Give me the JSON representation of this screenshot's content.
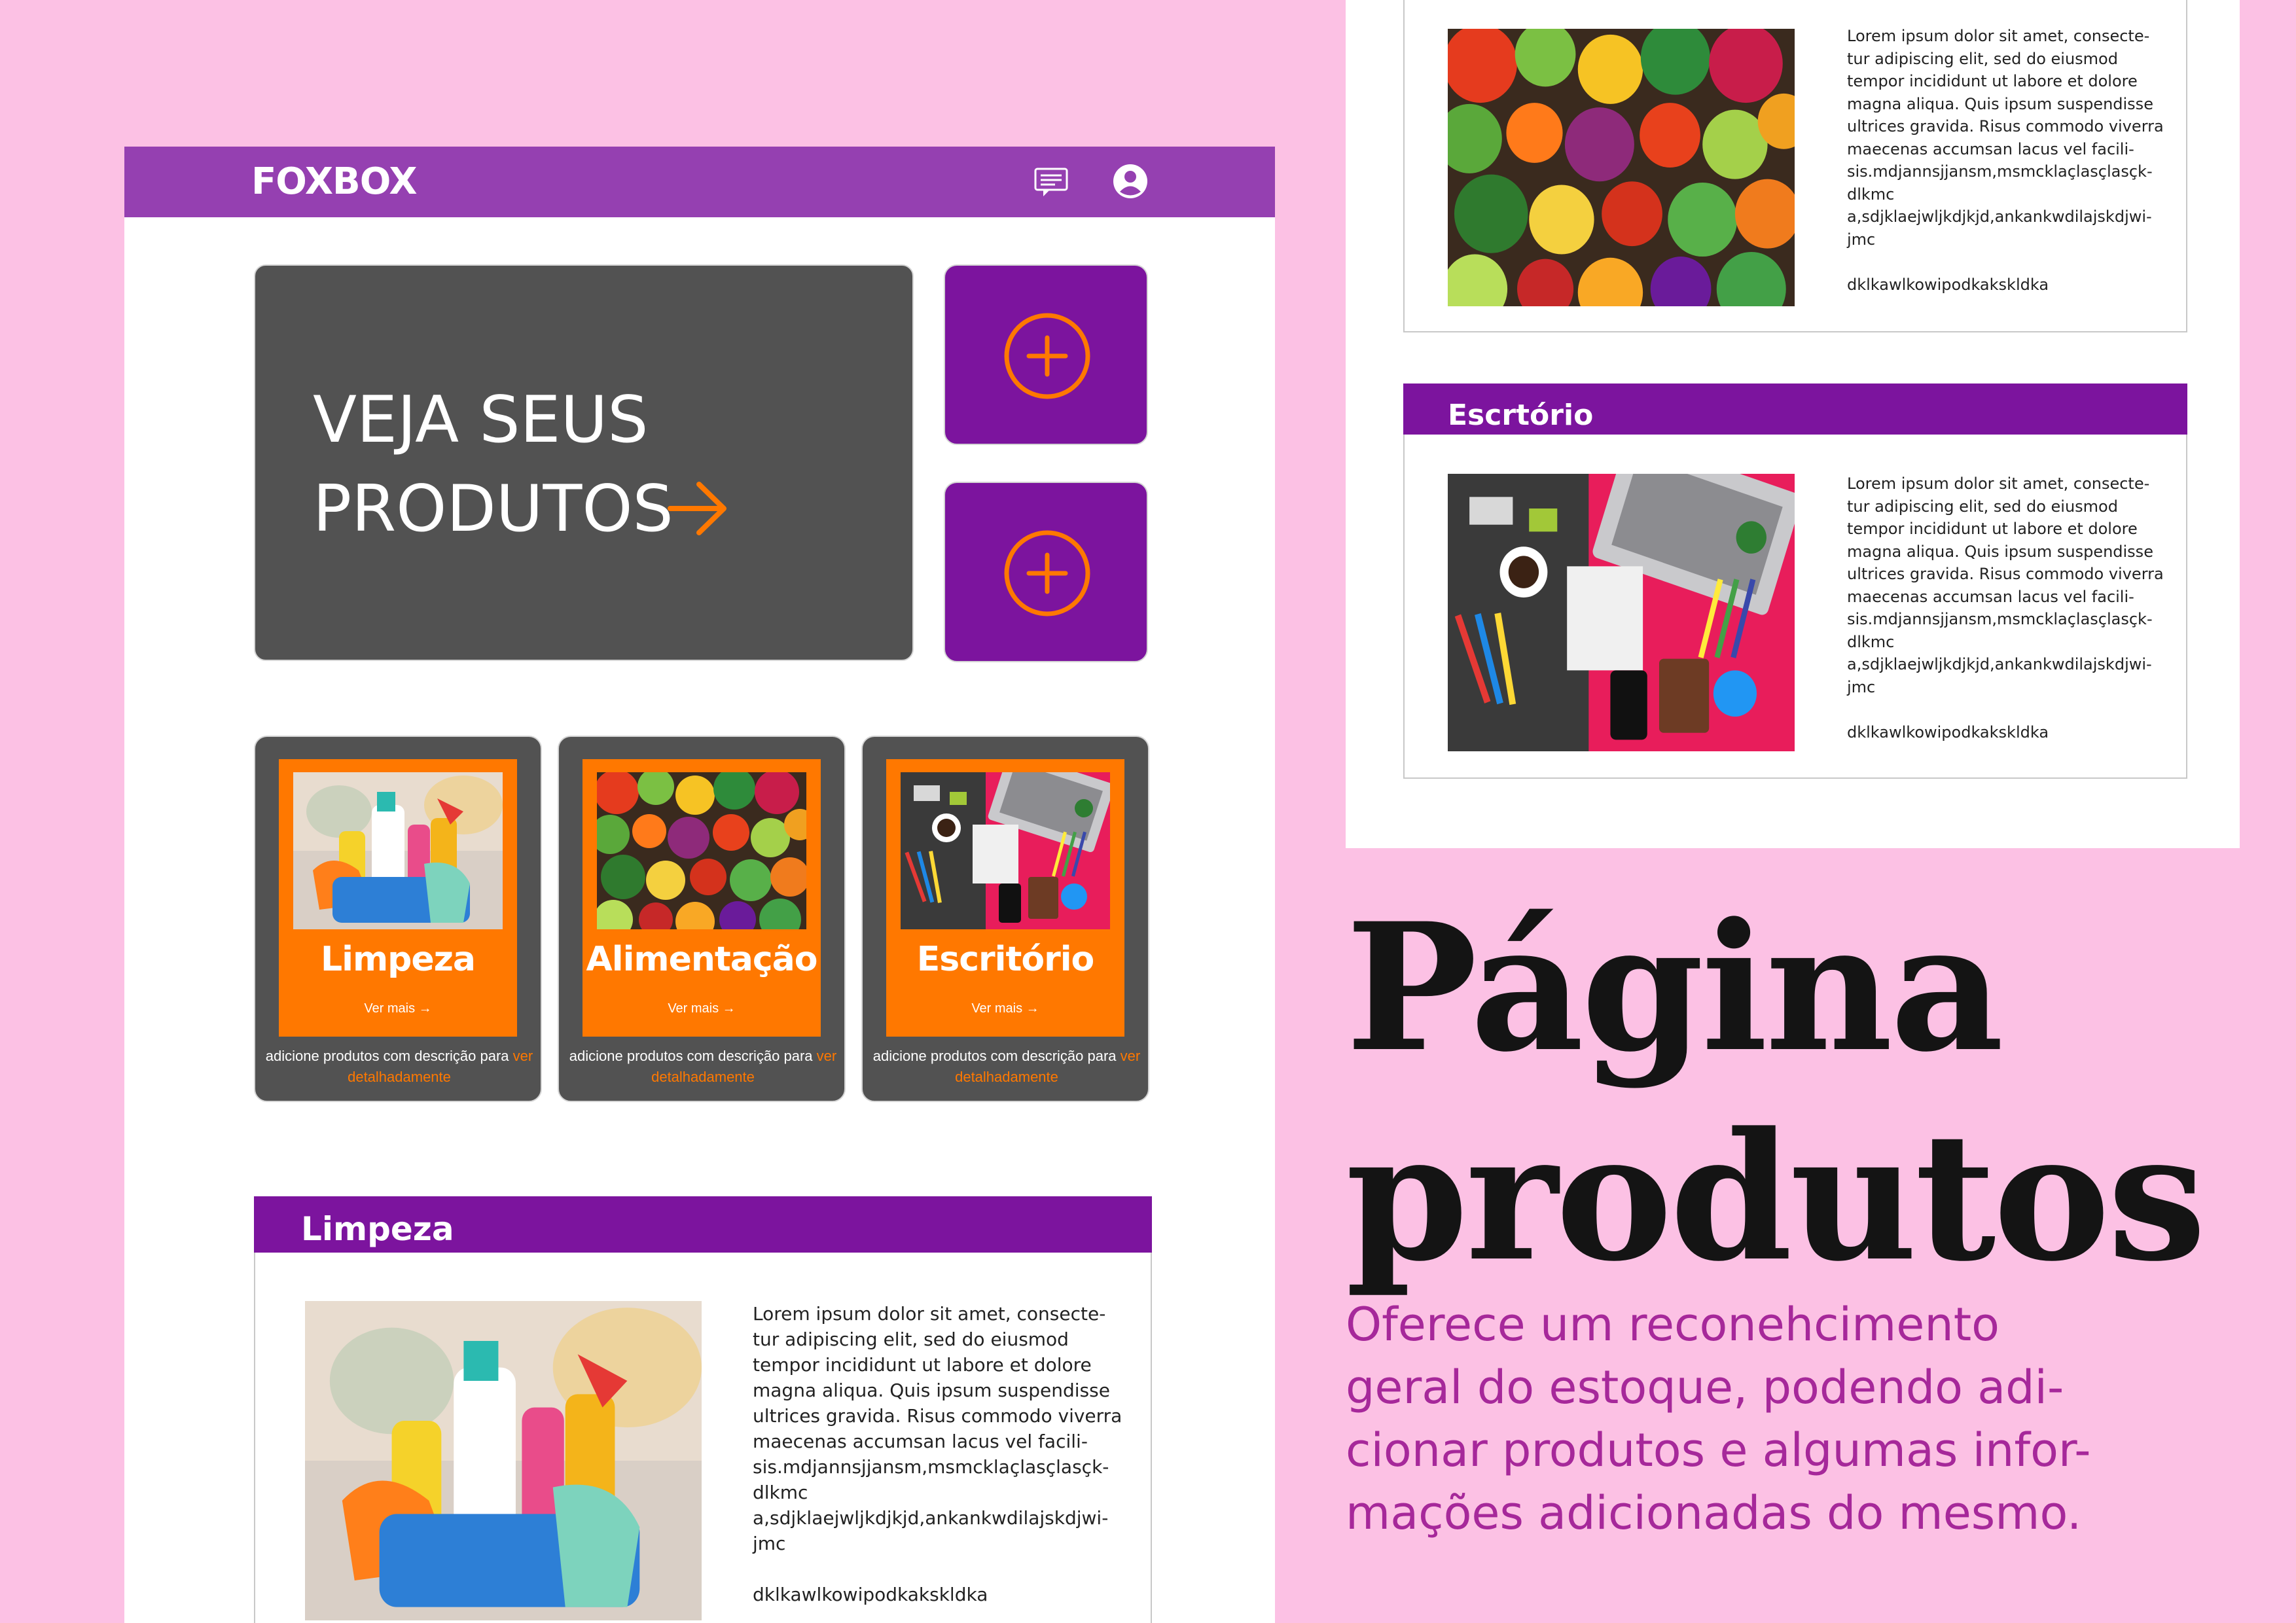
{
  "app": {
    "logo": "FOXBOX",
    "icons": {
      "chat": "chat-icon",
      "user": "user-account-icon"
    },
    "hero": {
      "line1": "VEJA SEUS",
      "line2": "PRODUTOS",
      "arrow_icon": "arrow-right-icon"
    },
    "add_buttons": [
      {
        "icon": "plus-circle-icon"
      },
      {
        "icon": "plus-circle-icon"
      }
    ],
    "categories": [
      {
        "title": "Limpeza",
        "more": "Ver mais →",
        "desc_prefix": "adicione produtos com descrição para ",
        "desc_link": "ver detalhadamente",
        "image": "cleaning-products-photo"
      },
      {
        "title": "Alimentação",
        "more": "Ver mais →",
        "desc_prefix": "adicione produtos com descrição para ",
        "desc_link": "ver detalhadamente",
        "image": "vegetables-photo"
      },
      {
        "title": "Escritório",
        "more": "Ver mais →",
        "desc_prefix": "adicione produtos com descrição para ",
        "desc_link": "ver detalhadamente",
        "image": "office-desk-photo"
      }
    ],
    "section": {
      "title": "Limpeza",
      "body": "Lorem ipsum dolor sit amet, consecte-\ntur adipiscing elit, sed do eiusmod\ntempor incididunt ut labore et dolore\nmagna aliqua. Quis ipsum suspendisse\nultrices gravida. Risus commodo viverra\nmaecenas accumsan lacus vel facili-\nsis.mdjannsjjansm,msmcklaçlasçlasçk-\ndlkmc\na,sdjklaejwljkdjkjd,ankankwdilajskdjwi-\njmc\n\ndklkawlkowipodkakskldka"
    }
  },
  "panel": {
    "top_card": {
      "body": "Lorem ipsum dolor sit amet, consecte-\ntur adipiscing elit, sed do eiusmod\ntempor incididunt ut labore et dolore\nmagna aliqua. Quis ipsum suspendisse\nultrices gravida. Risus commodo viverra\nmaecenas accumsan lacus vel facili-\nsis.mdjannsjjansm,msmcklaçlasçlasçk-\ndlkmc\na,sdjklaejwljkdjkjd,ankankwdilajskdjwi-\njmc\n\ndklkawlkowipodkakskldka"
    },
    "office_card": {
      "title": "Escrtório",
      "body": "Lorem ipsum dolor sit amet, consecte-\ntur adipiscing elit, sed do eiusmod\ntempor incididunt ut labore et dolore\nmagna aliqua. Quis ipsum suspendisse\nultrices gravida. Risus commodo viverra\nmaecenas accumsan lacus vel facili-\nsis.mdjannsjjansm,msmcklaçlasçlasçk-\ndlkmc\na,sdjklaejwljkdjkjd,ankankwdilajskdjwi-\njmc\n\ndklkawlkowipodkakskldka"
    }
  },
  "headline": "Página\nprodutos",
  "subtitle": "Oferece um reconehcimento\ngeral do estoque, podendo adi-\ncionar produtos e algumas infor-\nmações adicionadas do mesmo.",
  "colors": {
    "background": "#fcc1e4",
    "purple": "#7c149e",
    "topbar": "#9540b1",
    "orange": "#ff7800",
    "card": "#525252",
    "subtitle": "#a6289a"
  }
}
